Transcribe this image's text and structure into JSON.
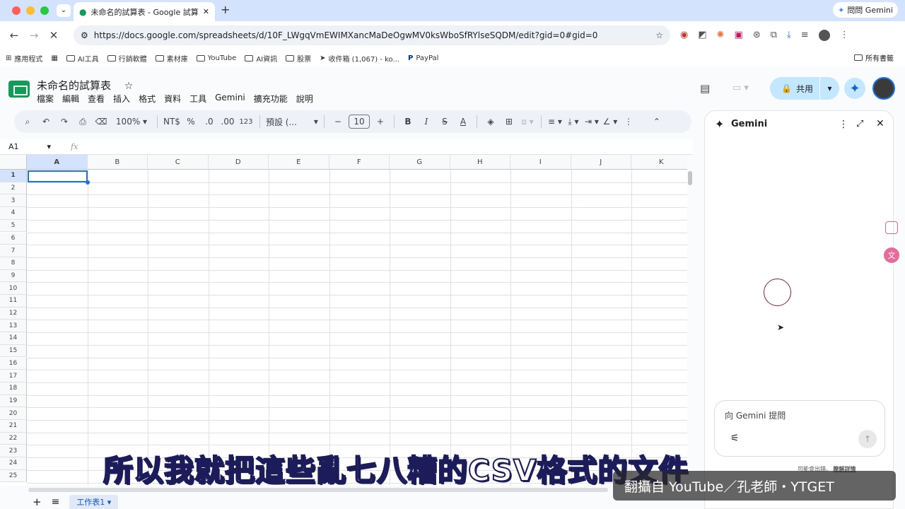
{
  "browser": {
    "tab_title": "未命名的試算表 - Google 試算",
    "url": "https://docs.google.com/spreadsheets/d/10F_LWgqVmEWIMXancMaDeOgwMV0ksWboSfRYlseSQDM/edit?gid=0#gid=0",
    "ask_gemini_label": "問問 Gemini",
    "all_bookmarks": "所有書籤"
  },
  "bookmarks": [
    "應用程式",
    "AI工具",
    "行銷軟體",
    "素材庫",
    "YouTube",
    "AI資訊",
    "股票",
    "收件箱 (1,067) - ko...",
    "PayPal"
  ],
  "doc": {
    "title": "未命名的試算表",
    "menus": [
      "檔案",
      "編輯",
      "查看",
      "插入",
      "格式",
      "資料",
      "工具",
      "Gemini",
      "擴充功能",
      "說明"
    ],
    "share_label": "共用"
  },
  "toolbar": {
    "zoom": "100%",
    "currency": "NT$",
    "percent": "%",
    "dec_decrease": ".0",
    "dec_increase": ".00",
    "number_format": "123",
    "font": "預設 (...",
    "font_size": "10"
  },
  "formula_bar": {
    "cell_ref": "A1",
    "fx": "fx"
  },
  "grid": {
    "columns": [
      "A",
      "B",
      "C",
      "D",
      "E",
      "F",
      "G",
      "H",
      "I",
      "J",
      "K"
    ],
    "rows": [
      "1",
      "2",
      "3",
      "4",
      "5",
      "6",
      "7",
      "8",
      "9",
      "10",
      "11",
      "12",
      "13",
      "14",
      "15",
      "16",
      "17",
      "18",
      "19",
      "20",
      "21",
      "22",
      "23",
      "24",
      "25"
    ],
    "selected_cell": "A1"
  },
  "sheets": {
    "tab_label": "工作表1"
  },
  "gemini": {
    "title": "Gemini",
    "input_placeholder": "向 Gemini 提問",
    "disclaimer": "可能會出錯。",
    "learn_more": "瞭解詳情"
  },
  "overlay": {
    "subtitle": "所以我就把這些亂七八糟的CSV格式的文件",
    "watermark": "翻攝自 YouTube／孔老師・YTGET"
  },
  "colors": {
    "tabstrip": "#d3e3fd",
    "share_button": "#c2e7ff",
    "selection": "#1a73e8",
    "sheets_green": "#0f9d58"
  }
}
